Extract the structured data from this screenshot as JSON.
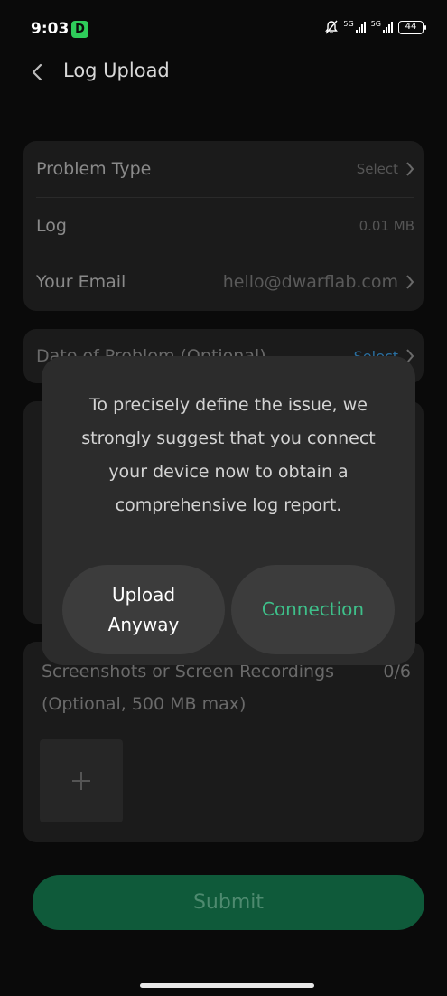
{
  "status_bar": {
    "time": "9:03",
    "app_badge": "D",
    "signal_1_label": "5G",
    "signal_2_label": "5G",
    "battery": "44"
  },
  "nav": {
    "title": "Log Upload",
    "back_icon": "chevron-left-icon"
  },
  "form": {
    "problem_type": {
      "label": "Problem Type",
      "value": "Select"
    },
    "log": {
      "label": "Log",
      "value": "0.01 MB"
    },
    "email": {
      "label": "Your Email",
      "value": "hello@dwarflab.com"
    },
    "date": {
      "label": "Date of Problem (Optional)",
      "value": "Select"
    },
    "screenshots": {
      "label": "Screenshots or Screen Recordings",
      "count": "0/6",
      "note": "(Optional, 500 MB max)",
      "add_icon": "plus-icon"
    },
    "submit_label": "Submit"
  },
  "dialog": {
    "message": "To precisely define the issue, we strongly suggest that you connect your device now to obtain a comprehensive log report.",
    "upload_line1": "Upload",
    "upload_line2": "Anyway",
    "connection_label": "Connection"
  },
  "colors": {
    "accent_green": "#3ec08a",
    "submit_bg": "#0f5a3a",
    "dialog_bg": "#2c2c2c"
  }
}
